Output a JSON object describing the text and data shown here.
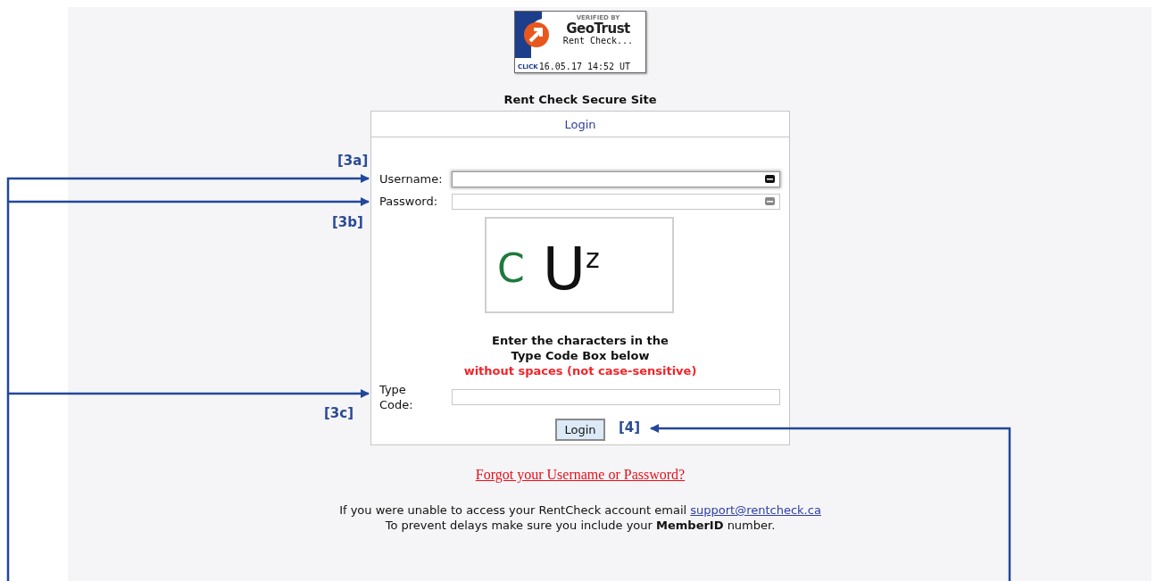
{
  "badge": {
    "verified_by": "VERIFIED BY",
    "brand": "GeoTrust",
    "site": "Rent Check...",
    "click": "CLICK",
    "timestamp": "16.05.17 14:52 UT"
  },
  "site_title": "Rent Check Secure Site",
  "login_box": {
    "title": "Login",
    "fields": [
      {
        "label": "Username:",
        "focused": true
      },
      {
        "label": "Password:",
        "focused": false
      }
    ],
    "captcha": [
      {
        "char": "C",
        "color": "#1e7a3c",
        "kind": "normal"
      },
      {
        "char": "U",
        "color": "#111111",
        "kind": "large"
      },
      {
        "char": "z",
        "color": "#111111",
        "kind": "raised"
      }
    ],
    "instructions": [
      "Enter the characters in the",
      "Type Code Box below"
    ],
    "warning": "without spaces (not case-sensitive)",
    "type_code": {
      "label": [
        "Type",
        "Code:"
      ]
    },
    "button": "Login"
  },
  "forgot_link": "Forgot your Username or Password?",
  "help": {
    "text": "If you were unable to access your RentCheck account email",
    "email": "support@rentcheck.ca",
    "note": "To prevent delays make sure you include your **MemberID** number."
  },
  "annotations": [
    {
      "label": "[3a]"
    },
    {
      "label": "[3b]"
    },
    {
      "label": "[3c]"
    },
    {
      "label": "[4]"
    }
  ]
}
